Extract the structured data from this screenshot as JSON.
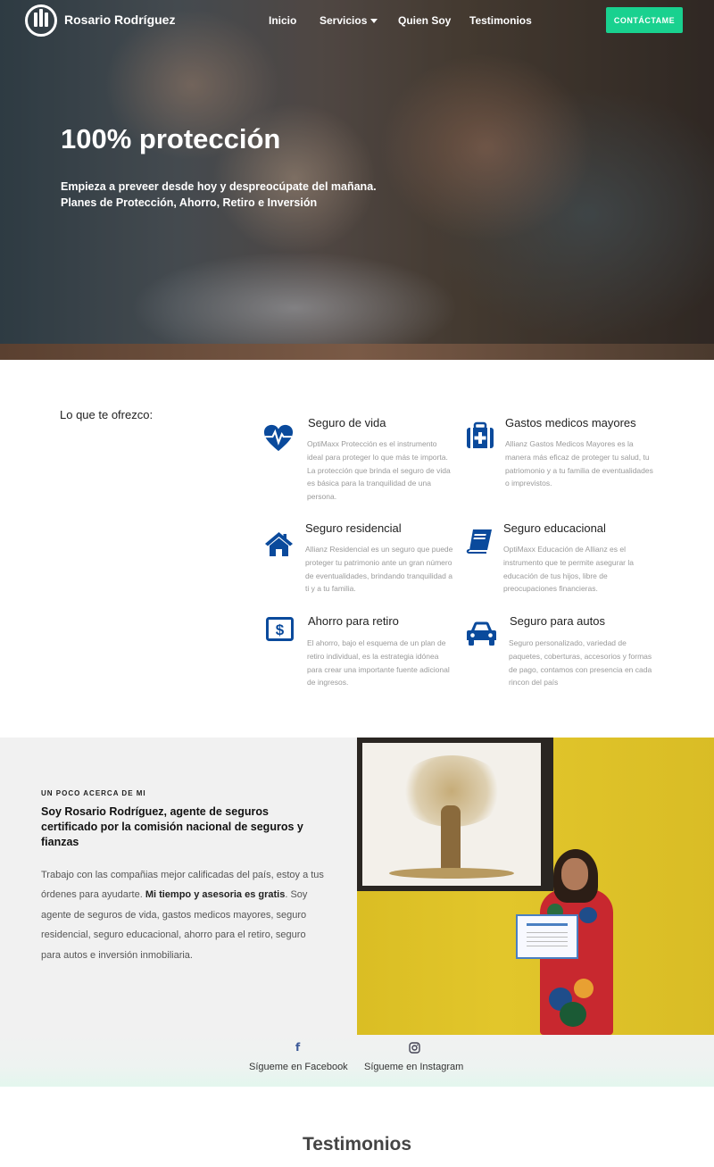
{
  "header": {
    "brand": "Rosario Rodríguez",
    "nav": [
      {
        "label": "Inicio"
      },
      {
        "label": "Servicios"
      },
      {
        "label": "Quien Soy"
      },
      {
        "label": "Testimonios"
      }
    ],
    "contact_label": "CONTÁCTAME",
    "contact_color": "#19d18f"
  },
  "hero": {
    "title": "100% protección",
    "subtitle_line1": "Empieza a preveer desde hoy y despreocúpate del mañana.",
    "subtitle_line2": "Planes de Protección, Ahorro, Retiro e Inversión"
  },
  "services": {
    "label": "Lo que te ofrezco:",
    "icon_color": "#0a4a9c",
    "items": [
      {
        "title": "Seguro de vida",
        "icon": "heartbeat-icon",
        "desc": "OptiMaxx Protección es el instrumento ideal para proteger lo que más te importa. La protección que brinda el seguro de vida es básica para la tranquilidad de una persona."
      },
      {
        "title": "Gastos medicos mayores",
        "icon": "medkit-icon",
        "desc": "Allianz Gastos Medicos Mayores es la manera más eficaz de proteger tu salud, tu patriomonio y a tu familia de eventualidades o imprevistos."
      },
      {
        "title": "Seguro residencial",
        "icon": "home-icon",
        "desc": "Allianz Residencial es un seguro que puede proteger tu patrimonio ante un gran número de eventualidades, brindando tranquilidad a ti y a tu familia."
      },
      {
        "title": "Seguro educacional",
        "icon": "book-icon",
        "desc": "OptiMaxx Educación de Allianz es el instrumento que te permite asegurar la educación de tus hijos, libre de preocupaciones financieras."
      },
      {
        "title": "Ahorro para retiro",
        "icon": "money-icon",
        "desc": "El ahorro, bajo el esquema de un plan de retiro individual, es la estrategia idónea para crear una importante fuente adicional de ingresos."
      },
      {
        "title": "Seguro para autos",
        "icon": "car-icon",
        "desc": "Seguro personalizado, variedad de paquetes, coberturas, accesorios y formas de pago, contamos con presencia en cada rincon del país"
      }
    ]
  },
  "about": {
    "kicker": "UN POCO ACERCA DE MI",
    "title": "Soy Rosario Rodríguez, agente de seguros certificado por la comisión nacional de seguros y fianzas",
    "body_before": "Trabajo con las compañias mejor calificadas del país, estoy a tus órdenes para ayudarte. ",
    "body_bold": "Mi tiempo y asesoria es gratis",
    "body_after": ". Soy agente de seguros de vida, gastos medicos mayores, seguro residencial, seguro educacional, ahorro para el retiro, seguro para autos e inversión inmobiliaria."
  },
  "social": {
    "facebook_label": "Sígueme en Facebook",
    "facebook_icon": "f",
    "instagram_label": "Sígueme en Instagram"
  },
  "testimonials": {
    "title": "Testimonios"
  }
}
